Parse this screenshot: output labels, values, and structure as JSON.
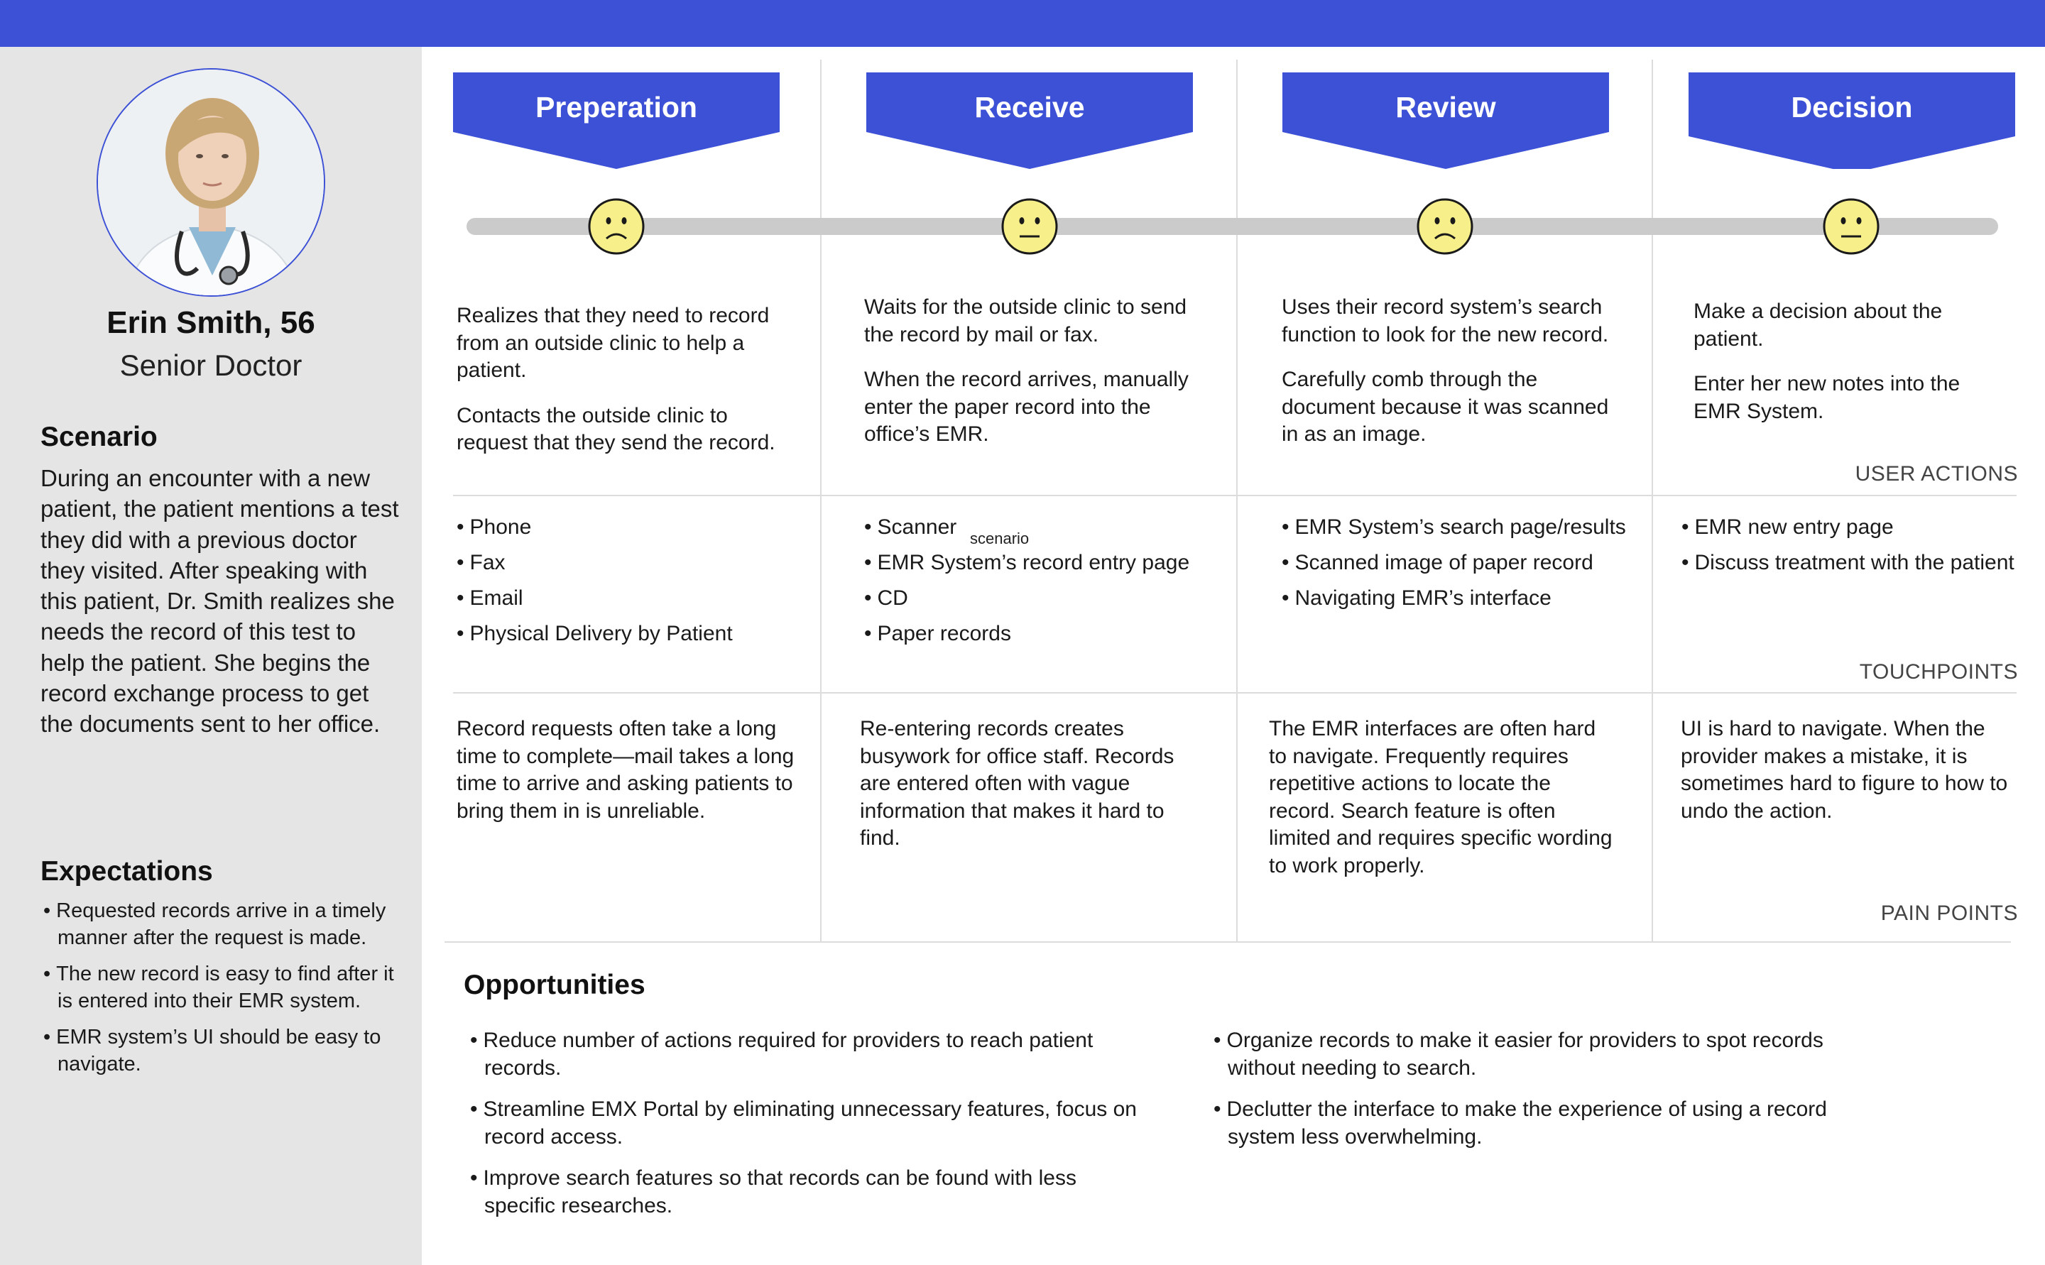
{
  "persona": {
    "name": "Erin Smith, 56",
    "role": "Senior Doctor",
    "scenario_heading": "Scenario",
    "scenario_text": "During an encounter with a new patient, the patient mentions a test they did with a previous doctor they visited. After speaking with this patient, Dr. Smith realizes she needs the record of this test to help the patient. She begins the record exchange process to get the documents sent to her office.",
    "expectations_heading": "Expectations",
    "expectations": [
      "Requested records arrive in a timely manner after the request is made.",
      "The new record is easy to find after it is entered into their EMR system.",
      "EMR system’s UI should be easy to navigate."
    ]
  },
  "stages": [
    {
      "title": "Preperation",
      "emotion": "sad",
      "actions": [
        "Realizes that they need to record from an outside clinic to help a patient.",
        "Contacts the outside clinic to request that they send the record."
      ],
      "touchpoints": [
        "Phone",
        "Fax",
        "Email",
        "Physical Delivery by Patient"
      ],
      "pain_points": "Record requests often take a long time to complete—mail takes a long time to arrive and asking patients to bring them in is unreliable."
    },
    {
      "title": "Receive",
      "emotion": "neutral",
      "actions": [
        "Waits for the outside clinic to send the record by mail or fax.",
        "When the record arrives, manually enter the paper record into the office’s EMR."
      ],
      "touchpoints": [
        "Scanner",
        "EMR System’s record entry page",
        "CD",
        "Paper records"
      ],
      "touchpoint_note": "scenario",
      "pain_points": "Re-entering records creates busywork for office staff. Records are entered often with vague information that makes it hard to find."
    },
    {
      "title": "Review",
      "emotion": "sad",
      "actions": [
        "Uses their record system’s search function to look for the new record.",
        "Carefully comb through the document because it was scanned in as an image."
      ],
      "touchpoints": [
        "EMR System’s search page/results",
        "Scanned image of paper record",
        "Navigating EMR’s interface"
      ],
      "pain_points": "The EMR interfaces are often hard to navigate. Frequently requires repetitive actions to locate the record. Search feature is often limited and requires specific wording to work properly."
    },
    {
      "title": "Decision",
      "emotion": "neutral",
      "actions": [
        "Make a decision about the patient.",
        "Enter her new notes into the EMR System."
      ],
      "touchpoints": [
        "EMR new entry page",
        "Discuss treatment with the patient"
      ],
      "pain_points": "UI is hard to navigate. When the provider makes a mistake, it is sometimes hard to figure to how to undo the action."
    }
  ],
  "row_labels": {
    "user_actions": "USER ACTIONS",
    "touchpoints": "TOUCHPOINTS",
    "pain_points": "PAIN POINTS"
  },
  "opportunities": {
    "heading": "Opportunities",
    "left": [
      "Reduce number of actions required for providers to reach patient records.",
      "Streamline EMX Portal by eliminating unnecessary features, focus on record access.",
      "Improve search features so that records can be found with less specific researches."
    ],
    "right": [
      "Organize records to make it easier for providers to spot records without needing to search.",
      "Declutter the interface to make the experience of using a record system less overwhelming."
    ]
  },
  "colors": {
    "accent": "#3d51d6",
    "sidebar_bg": "#e5e5e5",
    "face_fill": "#f7f08a",
    "timeline": "#cbcbcb"
  }
}
